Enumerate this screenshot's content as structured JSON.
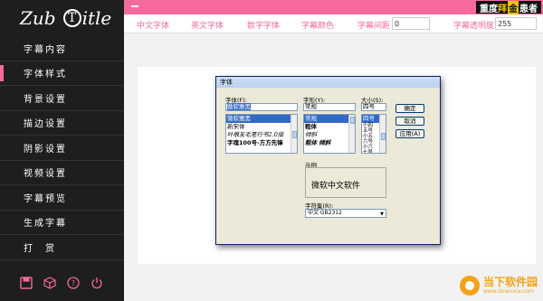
{
  "sidebar": {
    "logo_prefix": "Zub",
    "logo_circle": "T",
    "logo_suffix": "itle",
    "items": [
      {
        "label": "字幕内容"
      },
      {
        "label": "字体样式"
      },
      {
        "label": "背景设置"
      },
      {
        "label": "描边设置"
      },
      {
        "label": "阴影设置"
      },
      {
        "label": "视频设置"
      },
      {
        "label": "字幕预览"
      },
      {
        "label": "生成字幕"
      },
      {
        "label": "打　赏"
      }
    ],
    "active_index": 1,
    "bottom_icons": [
      "save-icon",
      "box-icon",
      "help-icon",
      "power-icon"
    ]
  },
  "topbar": {
    "brand_a": "重度",
    "brand_b": "拜",
    "brand_c": "金",
    "brand_d": "患者"
  },
  "tabs": {
    "cn_font": "中文字体",
    "en_font": "英文字体",
    "num_font": "数字字体",
    "color": "字幕颜色",
    "spacing_label": "字幕间距",
    "spacing_value": "0",
    "opacity_label": "字幕透明度",
    "opacity_value": "255"
  },
  "dialog": {
    "title": "字体",
    "font_label": "字体(F):",
    "font_value": "微软雅黑",
    "font_list": [
      "微软雅黑",
      "新宋体",
      "叶根友毛笔行书2.0版",
      "字魂100号-方方先锋"
    ],
    "style_label": "字形(Y):",
    "style_value": "常规",
    "style_list": [
      "常规",
      "粗体",
      "倾斜",
      "粗体 倾斜"
    ],
    "size_label": "大小(S):",
    "size_value": "四号",
    "size_list": [
      "四号",
      "小四",
      "五号",
      "小五",
      "六号",
      "小六",
      "七号"
    ],
    "ok": "确定",
    "cancel": "取消",
    "apply": "应用(A)",
    "sample_label": "示例",
    "sample_text": "微软中文软件",
    "charset_label": "字符集(R):",
    "charset_value": "中文 GB2312"
  },
  "watermark": {
    "text": "当下软件园",
    "url": "www.downxia.com"
  },
  "colors": {
    "accent": "#f46a9c",
    "sidebar_bg": "#1e1e1e",
    "watermark": "#f3a21a"
  }
}
